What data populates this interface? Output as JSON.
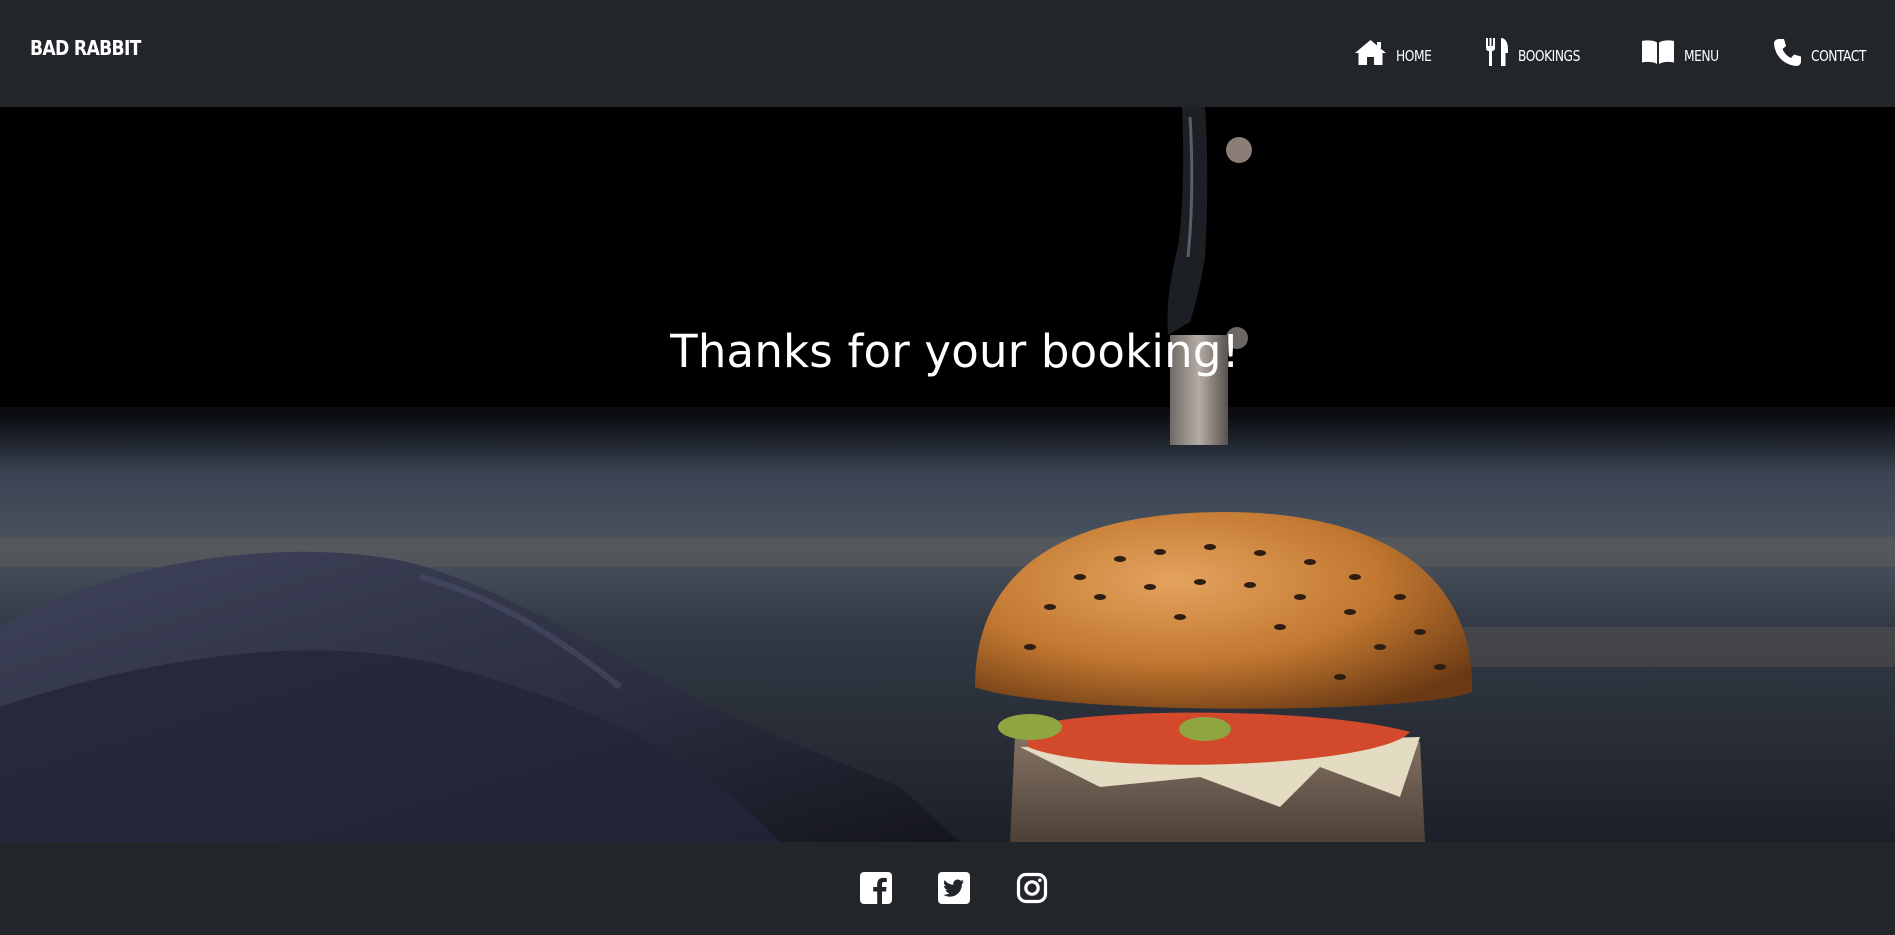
{
  "brand": {
    "name": "BAD RABBIT"
  },
  "nav": {
    "items": [
      {
        "label": "HOME",
        "icon": "home-icon"
      },
      {
        "label": "BOOKINGS",
        "icon": "cutlery-icon"
      },
      {
        "label": "MENU",
        "icon": "book-icon"
      },
      {
        "label": "CONTACT",
        "icon": "phone-icon"
      }
    ]
  },
  "hero": {
    "title": "Thanks for your booking!",
    "image": "burger-with-knife-photo"
  },
  "footer": {
    "social": [
      {
        "icon": "facebook-icon"
      },
      {
        "icon": "twitter-icon"
      },
      {
        "icon": "instagram-icon"
      }
    ]
  },
  "colors": {
    "bar_background": "#22262b",
    "text": "#ffffff",
    "hero_dark": "#000000"
  }
}
